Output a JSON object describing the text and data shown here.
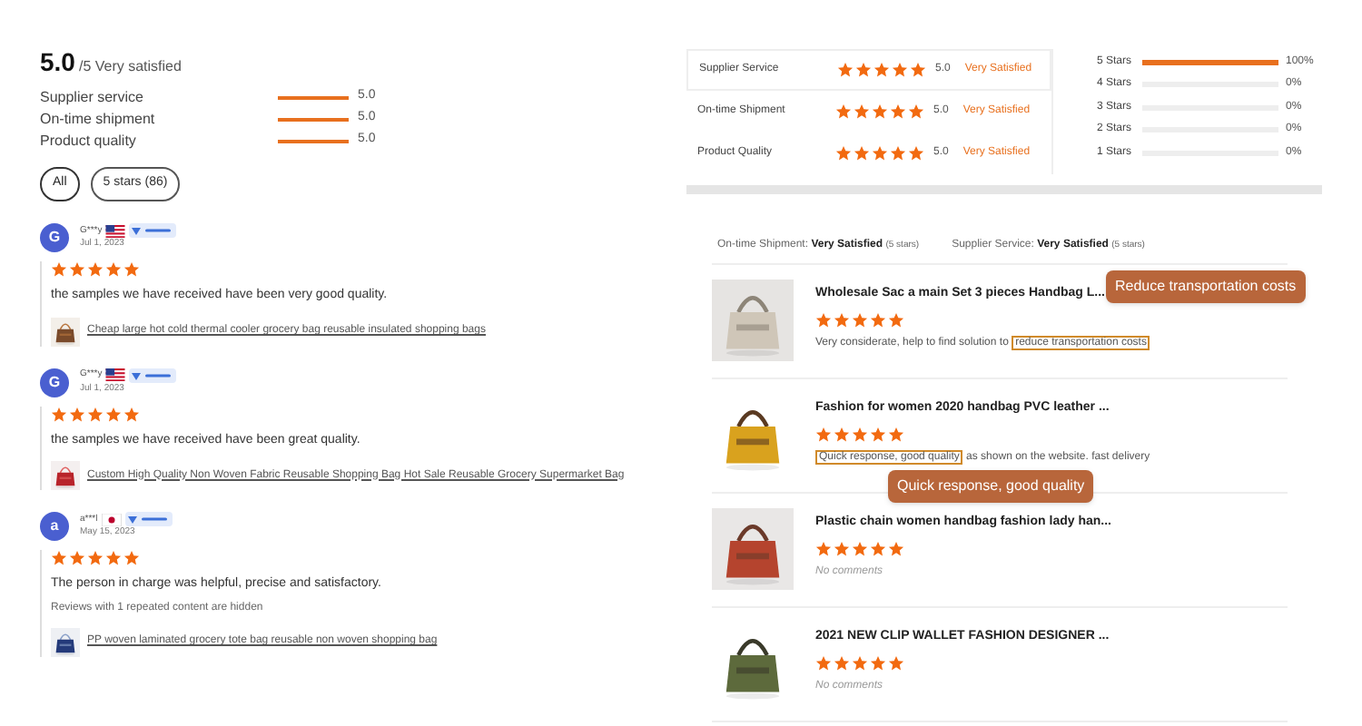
{
  "summary": {
    "score": "5.0",
    "suffix": "/5 Very satisfied",
    "ratings": [
      {
        "label": "Supplier service",
        "level": 1,
        "value": "5.0"
      },
      {
        "label": "On-time shipment",
        "level": 1,
        "value": "5.0"
      },
      {
        "label": "Product quality",
        "level": 1,
        "value": "5.0"
      }
    ]
  },
  "filters": [
    {
      "label": "All",
      "selected": true
    },
    {
      "label": "5 stars (86)",
      "selected": false
    }
  ],
  "reviews": [
    {
      "initial": "G",
      "name": "G***y",
      "kind": "us",
      "date": "Jul 1, 2023",
      "stars": 5,
      "text": "the samples we have received have been very good quality.",
      "product": "Cheap large hot cold thermal cooler grocery bag reusable insulated shopping bags"
    },
    {
      "initial": "G",
      "name": "G***y",
      "kind": "us",
      "date": "Jul 1, 2023",
      "stars": 5,
      "text": "the samples we have received have been great quality.",
      "product": "Custom High Quality Non Woven Fabric Reusable Shopping Bag Hot Sale Reusable Grocery Supermarket Bag"
    },
    {
      "initial": "a",
      "name": "a***l",
      "kind": "jp",
      "date": "May 15, 2023",
      "stars": 5,
      "text": "The person in charge was helpful, precise and satisfactory.",
      "note": "Reviews with 1 repeated content are hidden",
      "product": "PP woven laminated grocery tote bag reusable non woven shopping bag"
    }
  ],
  "supplier_table": [
    {
      "label": "Supplier Service",
      "stars": 5,
      "value": "5.0",
      "verdict": "Very Satisfied"
    },
    {
      "label": "On-time Shipment",
      "stars": 5,
      "value": "5.0",
      "verdict": "Very Satisfied"
    },
    {
      "label": "Product Quality",
      "stars": 5,
      "value": "5.0",
      "verdict": "Very Satisfied"
    }
  ],
  "distribution": [
    {
      "label": "5 Stars",
      "level": 1,
      "percent": "100%"
    },
    {
      "label": "4 Stars",
      "level": 0,
      "percent": "0%"
    },
    {
      "label": "3 Stars",
      "level": 0,
      "percent": "0%"
    },
    {
      "label": "2 Stars",
      "level": 0,
      "percent": "0%"
    },
    {
      "label": "1 Stars",
      "level": 0,
      "percent": "0%"
    }
  ],
  "buyer_summary": [
    {
      "label": "On-time Shipment:",
      "verdict": "Very Satisfied",
      "stars_note": "(5 stars)"
    },
    {
      "label": "Supplier Service:",
      "verdict": "Very Satisfied",
      "stars_note": "(5 stars)"
    }
  ],
  "products": [
    {
      "title": "Wholesale Sac a main Set 3 pieces Handbag L...",
      "stars": 5,
      "kind": "comment",
      "text_before": "Very considerate, help to find solution to ",
      "highlight": "reduce transportation costs",
      "callout": "Reduce transportation costs"
    },
    {
      "title": "Fashion for women 2020 handbag PVC leather ...",
      "stars": 5,
      "kind": "comment",
      "highlight": "Quick response, good quality",
      "text_after": " as shown on the website. fast delivery",
      "callout": "Quick response, good quality"
    },
    {
      "title": "Plastic chain women handbag fashion lady han...",
      "stars": 5,
      "kind": "empty",
      "text_before": "No comments"
    },
    {
      "title": "2021 NEW CLIP WALLET FASHION DESIGNER ...",
      "stars": 5,
      "kind": "empty",
      "text_before": "No comments"
    }
  ]
}
